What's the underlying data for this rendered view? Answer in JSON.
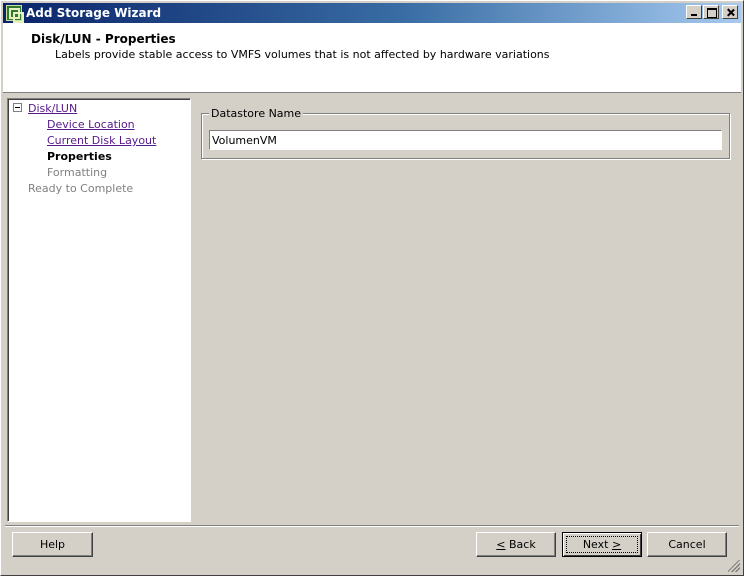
{
  "window": {
    "title": "Add Storage Wizard"
  },
  "header": {
    "title": "Disk/LUN - Properties",
    "subtitle": "Labels provide stable access to VMFS volumes that is not affected by hardware variations"
  },
  "nav": {
    "root": "Disk/LUN",
    "items": [
      {
        "label": "Device Location",
        "state": "link"
      },
      {
        "label": "Current Disk Layout",
        "state": "link"
      },
      {
        "label": "Properties",
        "state": "current"
      },
      {
        "label": "Formatting",
        "state": "disabled"
      }
    ],
    "final": "Ready to Complete"
  },
  "form": {
    "group_label": "Datastore Name",
    "datastore_name": "VolumenVM"
  },
  "buttons": {
    "help": "Help",
    "back_mnemonic": "<",
    "back_rest": " Back",
    "next_rest": "Next ",
    "next_mnemonic": ">",
    "cancel": "Cancel"
  },
  "colors": {
    "titlebar_start": "#0a246a",
    "link": "#551a8b",
    "face": "#d4d0c8"
  }
}
